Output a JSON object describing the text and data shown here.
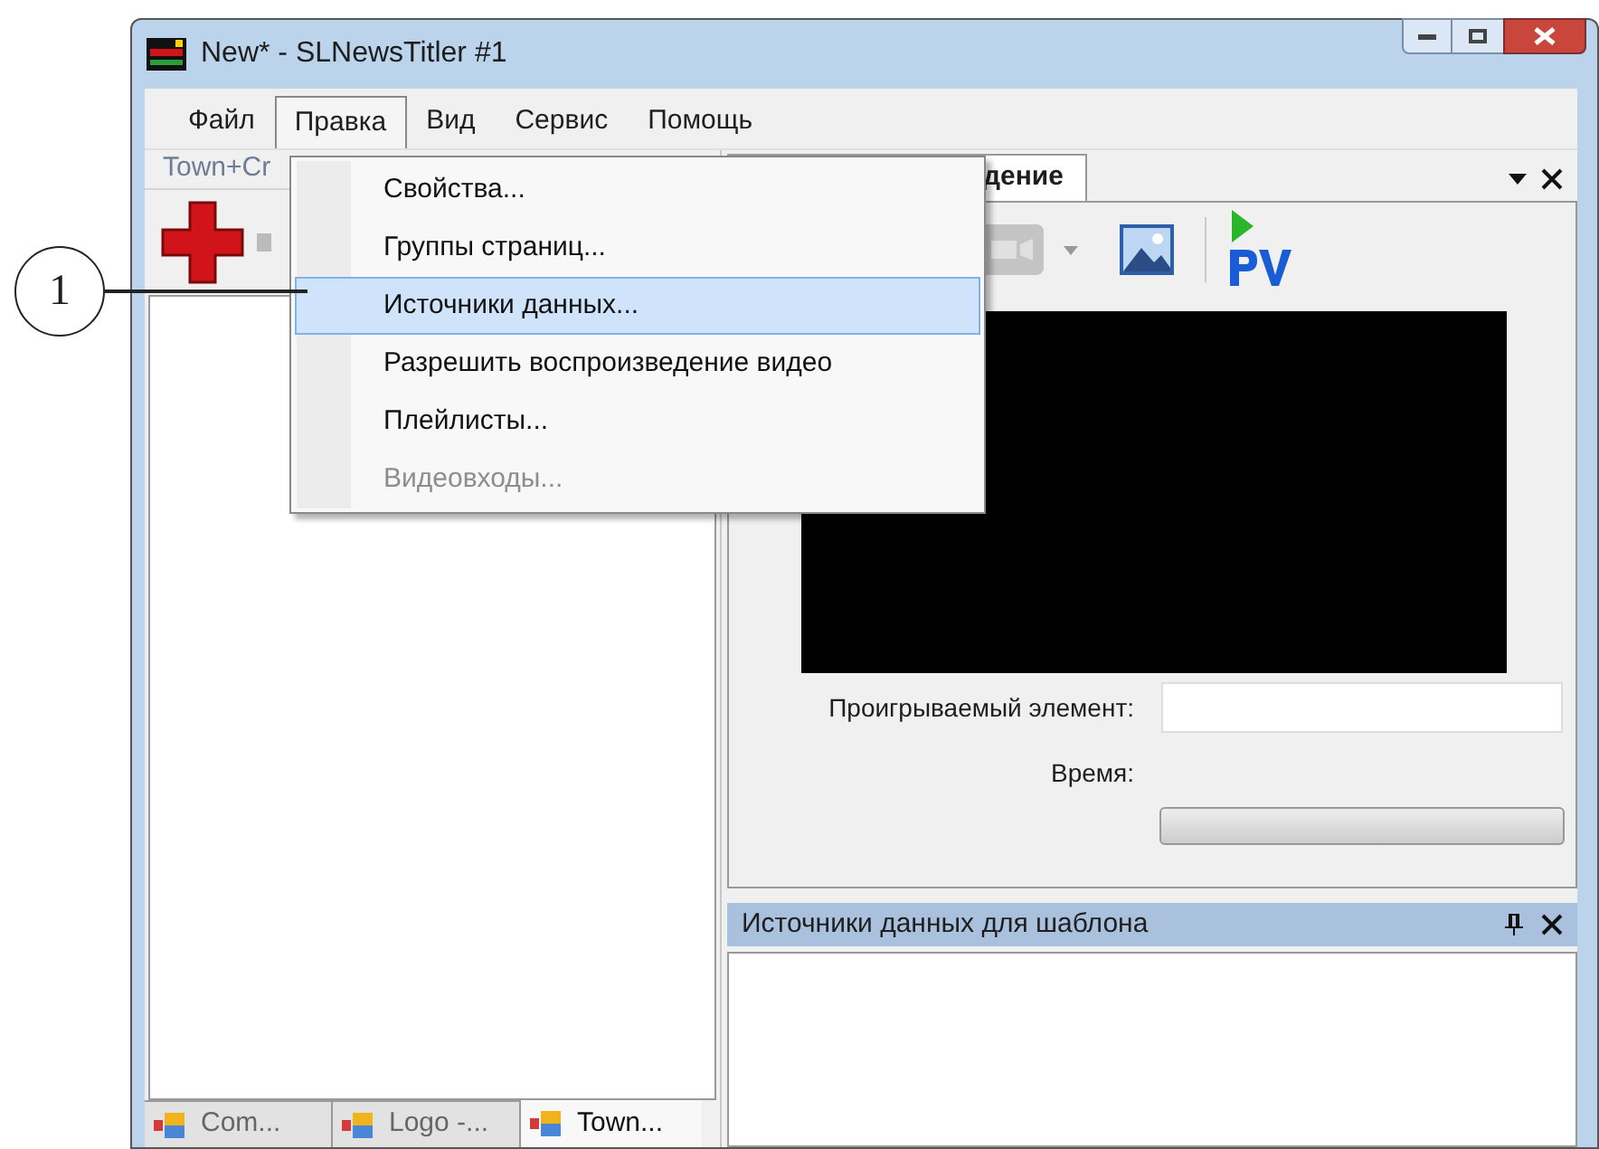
{
  "window": {
    "title": "New* - SLNewsTitler #1"
  },
  "menu_bar": [
    {
      "label": "Файл",
      "selected": false
    },
    {
      "label": "Правка",
      "selected": true
    },
    {
      "label": "Вид",
      "selected": false
    },
    {
      "label": "Сервис",
      "selected": false
    },
    {
      "label": "Помощь",
      "selected": false
    }
  ],
  "dropdown_menu": [
    {
      "label": "Свойства...",
      "selected": false,
      "disabled": false
    },
    {
      "label": "Группы страниц...",
      "selected": false,
      "disabled": false
    },
    {
      "label": "Источники данных...",
      "selected": true,
      "disabled": false
    },
    {
      "label": "Разрешить воспроизведение видео",
      "selected": false,
      "disabled": false
    },
    {
      "label": "Плейлисты...",
      "selected": false,
      "disabled": false
    },
    {
      "label": "Видеовходы...",
      "selected": false,
      "disabled": true
    }
  ],
  "left_panel": {
    "header": "Town+Cr",
    "tabs": [
      {
        "label": "Com...",
        "selected": false
      },
      {
        "label": "Logo -...",
        "selected": false
      },
      {
        "label": "Town...",
        "selected": true
      }
    ]
  },
  "preview_panel": {
    "tab": "дение",
    "fields": [
      {
        "label": "Проигрываемый элемент:",
        "kind": "input"
      },
      {
        "label": "Время:",
        "kind": "label"
      }
    ],
    "progress": {
      "level": 0
    }
  },
  "data_sources_panel": {
    "title": "Источники данных для шаблона"
  },
  "callout": {
    "label": "1"
  }
}
